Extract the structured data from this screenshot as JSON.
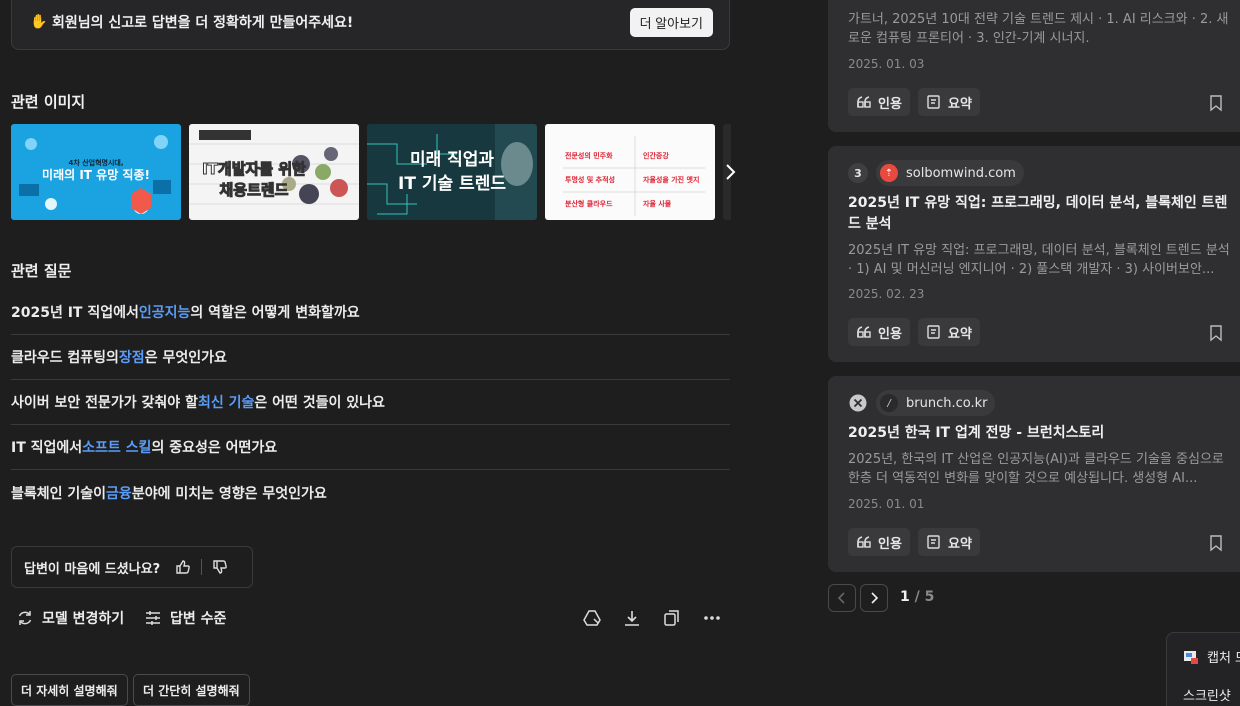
{
  "report_banner": {
    "message": "회원님의 신고로 답변을 더 정확하게 만들어주세요!",
    "button": "더 알아보기"
  },
  "related_images": {
    "title": "관련 이미지",
    "items": [
      {
        "caption": "4차 산업혁명시대, 미래의 IT 유망 직종!"
      },
      {
        "caption": "IT개발자를 위한 채용트렌드"
      },
      {
        "caption": "미래 직업과 IT 기술 트렌드"
      },
      {
        "caption": "전문성의 민주화 · 인간증강 · 투명성 및 추적성 · 자율성을 가진 엣지 · 분산형 클라우드 · 자율 사물"
      }
    ]
  },
  "related_questions": {
    "title": "관련 질문",
    "items": [
      {
        "pre": "2025년 IT 직업에서 ",
        "hl": "인공지능",
        "post": "의 역할은 어떻게 변화할까요"
      },
      {
        "pre": "클라우드 컴퓨팅의 ",
        "hl": "장점",
        "post": "은 무엇인가요"
      },
      {
        "pre": "사이버 보안 전문가가 갖춰야 할 ",
        "hl": "최신 기술",
        "post": "은 어떤 것들이 있나요"
      },
      {
        "pre": "IT 직업에서 ",
        "hl": "소프트 스킬",
        "post": "의 중요성은 어떤가요"
      },
      {
        "pre": "블록체인 기술이 ",
        "hl": "금융",
        "post": " 분야에 미치는 영향은 무엇인가요"
      }
    ]
  },
  "feedback": {
    "question": "답변이 마음에 드셨나요?"
  },
  "toolbar": {
    "change_model": "모델 변경하기",
    "answer_level": "답변 수준"
  },
  "chips": [
    "더 자세히 설명해줘",
    "더 간단히 설명해줘"
  ],
  "sources": {
    "cards": [
      {
        "snippet": "가트너, 2025년 10대 전략 기술 트렌드 제시 · 1. AI 리스크와 · 2. 새로운 컴퓨팅 프론티어 · 3. 인간-기계 시너지.",
        "date": "2025. 01. 03"
      },
      {
        "rank": "3",
        "domain": "solbomwind.com",
        "title": "2025년 IT 유망 직업: 프로그래밍, 데이터 분석, 블록체인 트렌드 분석",
        "snippet": "2025년 IT 유망 직업: 프로그래밍, 데이터 분석, 블록체인 트렌드 분석 · 1) AI 및 머신러닝 엔지니어 · 2) 풀스택 개발자 · 3) 사이버보안...",
        "date": "2025. 02. 23"
      },
      {
        "domain": "brunch.co.kr",
        "title": "2025년 한국 IT 업계 전망 - 브런치스토리",
        "snippet": "2025년, 한국의 IT 산업은 인공지능(AI)과 클라우드 기술을 중심으로 한층 더 역동적인 변화를 맞이할 것으로 예상됩니다. 생성형 AI...",
        "date": "2025. 01. 01"
      }
    ],
    "cite_label": "인용",
    "summary_label": "요약"
  },
  "pagination": {
    "current": "1",
    "total": " / 5"
  },
  "capture_popup": {
    "line1": "캡처 모",
    "line2": "스크린샷"
  }
}
